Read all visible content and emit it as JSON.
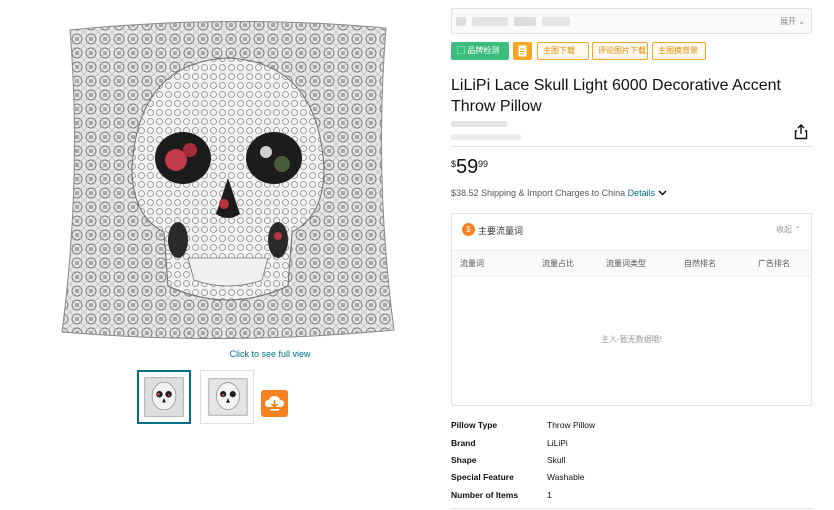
{
  "image_panel": {
    "see_full_view": "Click to see full view",
    "thumbnails": [
      {
        "name": "thumbnail-1",
        "selected": true
      },
      {
        "name": "thumbnail-2",
        "selected": false
      }
    ],
    "download_icon": "cloud-download-icon"
  },
  "toolbar": {
    "expand_label": "展开",
    "tags": {
      "brand_check": "品牌检测",
      "main_image_download": "主图下载",
      "review_image_download": "评论图片下载",
      "main_image_background": "主图换背景"
    }
  },
  "product": {
    "title": "LiLiPi Lace Skull Light 6000 Decorative Accent Throw Pillow",
    "price": {
      "currency": "$",
      "whole": "59",
      "fraction": "99"
    },
    "shipping_text": "$38.52 Shipping & Import Charges to China",
    "details_label": "Details"
  },
  "traffic_panel": {
    "title": "主要流量词",
    "collapse_label": "收起",
    "columns": [
      "流量词",
      "流量占比",
      "流量词类型",
      "自然排名",
      "广告排名"
    ],
    "empty_text": "主人-暂无数据哦!"
  },
  "specs": [
    {
      "key": "Pillow Type",
      "value": "Throw Pillow"
    },
    {
      "key": "Brand",
      "value": "LiLiPi"
    },
    {
      "key": "Shape",
      "value": "Skull"
    },
    {
      "key": "Special Feature",
      "value": "Washable"
    },
    {
      "key": "Number of Items",
      "value": "1"
    }
  ],
  "colors": {
    "link": "#007185",
    "accent_orange": "#f5821f",
    "tag_green": "#3dbd7d",
    "tag_outline": "#f5a623"
  }
}
